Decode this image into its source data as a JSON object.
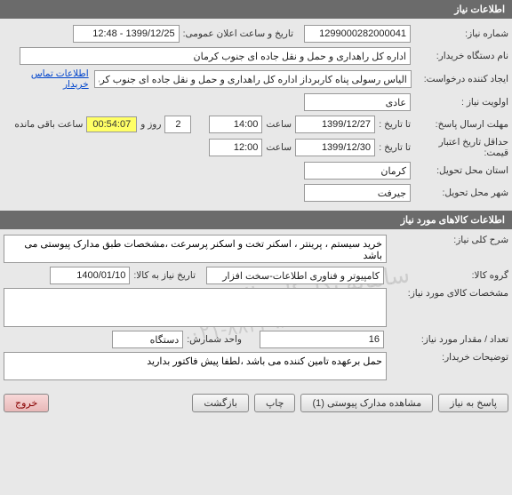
{
  "sections": {
    "need_info_header": "اطلاعات نیاز",
    "goods_info_header": "اطلاعات کالاهای مورد نیاز"
  },
  "need": {
    "number_label": "شماره نیاز:",
    "number_value": "1299000282000041",
    "announce_label": "تاریخ و ساعت اعلان عمومی:",
    "announce_value": "1399/12/25 - 12:48",
    "buyer_org_label": "نام دستگاه خریدار:",
    "buyer_org_value": "اداره کل راهداری و حمل و نقل جاده ای جنوب کرمان",
    "requester_label": "ایجاد کننده درخواست:",
    "requester_value": "الیاس رسولی پناه کاربرداز اداره کل راهداری و حمل و نقل جاده ای جنوب کرمان",
    "buyer_contact_link": "اطلاعات تماس خریدار",
    "priority_label": "اولویت نیاز :",
    "priority_value": "عادی",
    "deadline_label": "مهلت ارسال پاسخ:",
    "deadline_to_label": "تا تاریخ :",
    "deadline_date": "1399/12/27",
    "time_label": "ساعت",
    "deadline_time": "14:00",
    "days_value": "2",
    "days_label": "روز و",
    "timer_value": "00:54:07",
    "remaining_label": "ساعت باقی مانده",
    "min_validity_label": "حداقل تاریخ اعتبار قیمت:",
    "min_validity_to": "تا تاریخ :",
    "min_validity_date": "1399/12/30",
    "min_validity_time": "12:00",
    "province_label": "استان محل تحویل:",
    "province_value": "کرمان",
    "city_label": "شهر محل تحویل:",
    "city_value": "جیرفت"
  },
  "goods": {
    "desc_label": "شرح کلی نیاز:",
    "desc_value": "خرید سیستم ، پرینتر ، اسکنر تخت و اسکنر پرسرعت ،مشخصات طبق مدارک پیوستی می باشد",
    "group_label": "گروه کالا:",
    "group_value": "کامپیوتر و فناوری اطلاعات-سخت افزار",
    "need_by_label": "تاریخ نیاز به کالا:",
    "need_by_value": "1400/01/10",
    "spec_label": "مشخصات کالای مورد نیاز:",
    "spec_value": "",
    "qty_label": "تعداد / مقدار مورد نیاز:",
    "qty_value": "16",
    "unit_label": "واحد شمارش:",
    "unit_value": "دستگاه",
    "buyer_notes_label": "توضیحات خریدار:",
    "buyer_notes_value": "حمل برعهده تامین کننده می باشد ،لطفا پیش فاکتور بدارید"
  },
  "buttons": {
    "respond": "پاسخ به نیاز",
    "attachments": "مشاهده مدارک پیوستی  (1)",
    "print": "چاپ",
    "back": "بازگشت",
    "exit": "خروج"
  },
  "watermark": {
    "main": "سامانه تدارکات الکترونیکی دولت",
    "sub": "۰۲۱-۸۸۳۴۹۶۷۰-۵"
  }
}
